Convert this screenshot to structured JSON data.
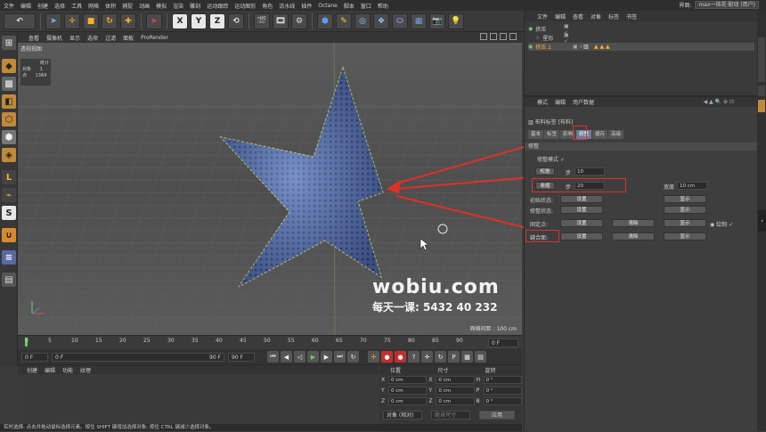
{
  "menubar": {
    "items": [
      "文件",
      "编辑",
      "创建",
      "选择",
      "工具",
      "网格",
      "体积",
      "捕捉",
      "动画",
      "模拟",
      "渲染",
      "雕刻",
      "运动跟踪",
      "运动图形",
      "角色",
      "流水线",
      "插件",
      "Octane",
      "脚本",
      "窗口",
      "帮助"
    ],
    "layout_label": "界面:",
    "layout_value": "max一核花·配动 (用户)"
  },
  "toolbar": {
    "axis_x": "X",
    "axis_y": "Y",
    "axis_z": "Z"
  },
  "viewport": {
    "menu": [
      "查看",
      "摄像机",
      "显示",
      "选项",
      "过滤",
      "面板",
      "ProRender"
    ],
    "label": "透视视图",
    "hud_title": "统计",
    "hud_objects_label": "对象",
    "hud_objects_value": "1",
    "hud_points_label": "点",
    "hud_points_value": "1364",
    "grid_info": "网格间距 : 100 cm",
    "watermark_site": "wobiu.com",
    "watermark_tag": "每天一课: 5432 40 232"
  },
  "timeline": {
    "ticks": [
      "0",
      "5",
      "10",
      "15",
      "20",
      "25",
      "30",
      "35",
      "40",
      "45",
      "50",
      "55",
      "60",
      "65",
      "70",
      "75",
      "80",
      "85",
      "90"
    ],
    "frame_right": "0 F",
    "start": "0 F",
    "current": "0 F",
    "end": "90 F",
    "end2": "90 F"
  },
  "material": {
    "menu": [
      "创建",
      "编辑",
      "功能",
      "纹理"
    ]
  },
  "coords": {
    "headers": [
      "位置",
      "尺寸",
      "旋转"
    ],
    "rows": [
      {
        "k1": "X",
        "v1": "0 cm",
        "k2": "X",
        "v2": "0 cm",
        "k3": "H",
        "v3": "0 °"
      },
      {
        "k1": "Y",
        "v1": "0 cm",
        "k2": "Y",
        "v2": "0 cm",
        "k3": "P",
        "v3": "0 °"
      },
      {
        "k1": "Z",
        "v1": "0 cm",
        "k2": "Z",
        "v2": "0 cm",
        "k3": "B",
        "v3": "0 °"
      }
    ],
    "mode": "对象 (相对)",
    "size_mode": "绝对尺寸",
    "apply": "应用"
  },
  "statusbar": {
    "text": "实时选择: 点击并拖动鼠标选择元素。按住 SHIFT 键增加选择对象; 按住 CTRL 键减少选择对象。"
  },
  "objects": {
    "menu": [
      "文件",
      "编辑",
      "查看",
      "对象",
      "标签",
      "书签"
    ],
    "rows": [
      {
        "name": "挤压"
      },
      {
        "name": "星形"
      },
      {
        "name": "挤压.1"
      }
    ]
  },
  "attributes": {
    "menu": [
      "模式",
      "编辑",
      "用户数据"
    ],
    "title": "布料标签 [布料]",
    "tabs": [
      "基本",
      "标签",
      "影响",
      "修整",
      "缓存",
      "高级"
    ],
    "active_tab": "修整",
    "section": "修整",
    "dress_mode": "修整模式",
    "relax_btn": "松弛",
    "relax_step_label": "步",
    "relax_step_value": "10",
    "shrink_btn": "收缩",
    "shrink_step_label": "步",
    "shrink_step_value": "20",
    "width_label": "宽度",
    "width_value": "10 cm",
    "init_state": "初始状态:",
    "dress_state": "修整状态:",
    "fix_points": "固定点:",
    "seam_points": "缝合面:",
    "set": "设置",
    "show": "显示",
    "clear": "清除",
    "draw": "绘制"
  },
  "colors": {
    "accent_red": "#e0302a",
    "active_tab": "#6a7d9a",
    "star_mesh": "#4a6bb5"
  }
}
